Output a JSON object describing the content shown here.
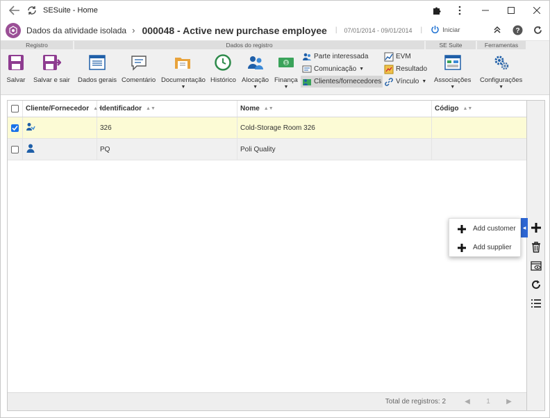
{
  "window": {
    "title": "SESuite - Home"
  },
  "header": {
    "breadcrumb": "Dados da atividade isolada",
    "record_title": "000048 - Active new purchase employee",
    "dates": "07/01/2014 - 09/01/2014",
    "start_label": "Iniciar"
  },
  "ribbon": {
    "groups": [
      "Registro",
      "Dados do registro",
      "SE Suite",
      "Ferramentas"
    ],
    "buttons": {
      "salvar": "Salvar",
      "salvar_sair": "Salvar e sair",
      "dados_gerais": "Dados gerais",
      "comentario": "Comentário",
      "documentacao": "Documentação",
      "historico": "Histórico",
      "alocacao": "Alocação",
      "financa": "Finança",
      "parte_interessada": "Parte interessada",
      "comunicacao": "Comunicação",
      "clientes_fornecedores": "Clientes/fornecedores",
      "evm": "EVM",
      "resultado": "Resultado",
      "vinculo": "Vínculo",
      "associacoes": "Associações",
      "configuracoes": "Configurações"
    }
  },
  "grid": {
    "columns": [
      "Cliente/Fornecedor",
      "Identificador",
      "Nome",
      "Código"
    ],
    "rows": [
      {
        "type": "customer",
        "identificador": "326",
        "nome": "Cold-Storage Room 326",
        "codigo": "",
        "checked": true
      },
      {
        "type": "supplier",
        "identificador": "PQ",
        "nome": "Poli Quality",
        "codigo": "",
        "checked": false
      }
    ],
    "total": "Total de registros: 2",
    "page": "1"
  },
  "popup": {
    "add_customer": "Add customer",
    "add_supplier": "Add supplier"
  },
  "colors": {
    "accent": "#2d66d4",
    "brand": "#9b4f96",
    "selected_row": "#fcfbd5"
  }
}
